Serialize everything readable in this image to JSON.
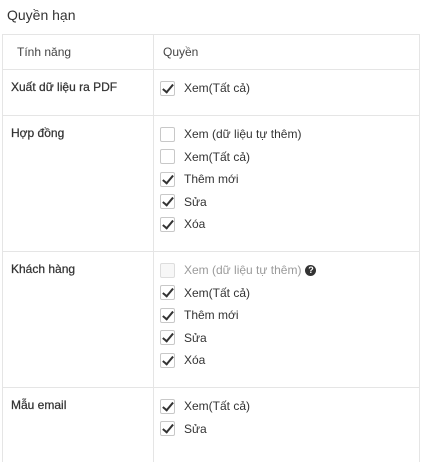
{
  "section": {
    "title": "Quyền hạn"
  },
  "table": {
    "headers": {
      "feature": "Tính năng",
      "permission": "Quyền"
    }
  },
  "features": [
    {
      "name": "Xuất dữ liệu ra PDF",
      "options": [
        {
          "label": "Xem(Tất cả)",
          "checked": true,
          "disabled": false
        }
      ]
    },
    {
      "name": "Hợp đồng",
      "options": [
        {
          "label": "Xem (dữ liệu tự thêm)",
          "checked": false,
          "disabled": false
        },
        {
          "label": "Xem(Tất cả)",
          "checked": false,
          "disabled": false
        },
        {
          "label": "Thêm mới",
          "checked": true,
          "disabled": false
        },
        {
          "label": "Sửa",
          "checked": true,
          "disabled": false
        },
        {
          "label": "Xóa",
          "checked": true,
          "disabled": false
        }
      ]
    },
    {
      "name": "Khách hàng",
      "options": [
        {
          "label": "Xem (dữ liệu tự thêm)",
          "checked": false,
          "disabled": true,
          "help_icon": "question-circle-icon"
        },
        {
          "label": "Xem(Tất cả)",
          "checked": true,
          "disabled": false
        },
        {
          "label": "Thêm mới",
          "checked": true,
          "disabled": false
        },
        {
          "label": "Sửa",
          "checked": true,
          "disabled": false
        },
        {
          "label": "Xóa",
          "checked": true,
          "disabled": false
        }
      ]
    },
    {
      "name": "Mẫu email",
      "options": [
        {
          "label": "Xem(Tất cả)",
          "checked": true,
          "disabled": false
        },
        {
          "label": "Sửa",
          "checked": true,
          "disabled": false
        }
      ]
    }
  ]
}
